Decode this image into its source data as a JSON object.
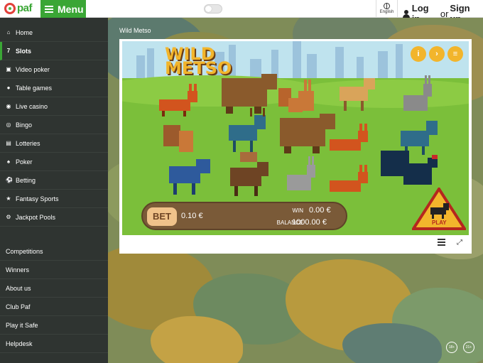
{
  "header": {
    "brand": "paf",
    "menu_label": "Menu",
    "language": "English",
    "login": "Log in",
    "or": "or",
    "signup": "Sign up"
  },
  "sidebar": {
    "items": [
      {
        "label": "Home",
        "icon": "home-icon"
      },
      {
        "label": "Slots",
        "icon": "slots-icon",
        "active": true
      },
      {
        "label": "Video poker",
        "icon": "video-poker-icon"
      },
      {
        "label": "Table games",
        "icon": "table-games-icon"
      },
      {
        "label": "Live casino",
        "icon": "live-casino-icon"
      },
      {
        "label": "Bingo",
        "icon": "bingo-icon"
      },
      {
        "label": "Lotteries",
        "icon": "lotteries-icon"
      },
      {
        "label": "Poker",
        "icon": "poker-icon"
      },
      {
        "label": "Betting",
        "icon": "betting-icon"
      },
      {
        "label": "Fantasy Sports",
        "icon": "fantasy-sports-icon"
      },
      {
        "label": "Jackpot Pools",
        "icon": "jackpot-pools-icon"
      }
    ],
    "secondary": [
      "Competitions",
      "Winners",
      "About us",
      "Club Paf",
      "Play it Safe",
      "Helpdesk"
    ]
  },
  "game": {
    "title": "Wild Metso",
    "logo_line1": "WILD",
    "logo_line2": "METSO",
    "bet_label": "BET",
    "bet_value": "0.10 €",
    "win_label": "WIN",
    "win_value": "0.00 €",
    "balance_label": "BALANCE",
    "balance_value": "1000.00 €",
    "play_label": "PLAY",
    "info_icon": "i"
  },
  "badges": [
    "18+",
    "21+"
  ],
  "colors": {
    "brand_green": "#3aa635",
    "sidebar_bg": "#2f3431",
    "accent_gold": "#f2b52c"
  }
}
